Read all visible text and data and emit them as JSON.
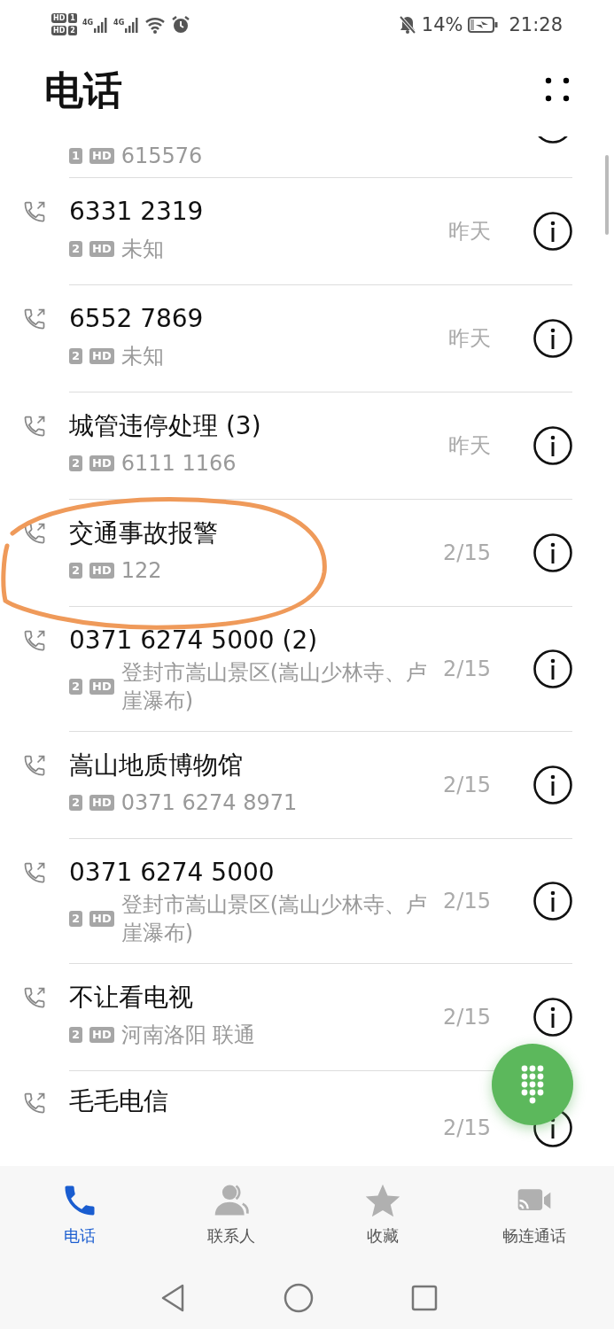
{
  "status_bar": {
    "sims": [
      {
        "hd": "HD",
        "slot": "1"
      },
      {
        "hd": "HD",
        "slot": "2"
      }
    ],
    "networks": [
      "4G",
      "4G"
    ],
    "battery": "14%",
    "time": "21:28"
  },
  "title": "电话",
  "calls": [
    {
      "kind": "partial",
      "sim": "1",
      "quality": "HD",
      "detail": "615576"
    },
    {
      "kind": "full",
      "name": "6331 2319",
      "sim": "2",
      "quality": "HD",
      "detail": "未知",
      "time": "昨天",
      "circled": false
    },
    {
      "kind": "full",
      "name": "6552 7869",
      "sim": "2",
      "quality": "HD",
      "detail": "未知",
      "time": "昨天",
      "circled": false
    },
    {
      "kind": "full",
      "name": "城管违停处理 (3)",
      "sim": "2",
      "quality": "HD",
      "detail": "6111 1166",
      "time": "昨天",
      "circled": false
    },
    {
      "kind": "full",
      "name": "交通事故报警",
      "sim": "2",
      "quality": "HD",
      "detail": "122",
      "time": "2/15",
      "circled": true
    },
    {
      "kind": "full",
      "name": "0371 6274 5000 (2)",
      "sim": "2",
      "quality": "HD",
      "detail": "登封市嵩山景区(嵩山少林寺、卢崖瀑布)",
      "time": "2/15",
      "circled": false
    },
    {
      "kind": "full",
      "name": "嵩山地质博物馆",
      "sim": "2",
      "quality": "HD",
      "detail": "0371 6274 8971",
      "time": "2/15",
      "circled": false
    },
    {
      "kind": "full",
      "name": "0371 6274 5000",
      "sim": "2",
      "quality": "HD",
      "detail": "登封市嵩山景区(嵩山少林寺、卢崖瀑布)",
      "time": "2/15",
      "circled": false
    },
    {
      "kind": "full",
      "name": "不让看电视",
      "sim": "2",
      "quality": "HD",
      "detail": "河南洛阳 联通",
      "time": "2/15",
      "circled": false
    },
    {
      "kind": "cut",
      "name": "毛毛电信",
      "time": "2/15"
    }
  ],
  "nav": {
    "tabs": [
      {
        "label": "电话",
        "selected": true
      },
      {
        "label": "联系人",
        "selected": false
      },
      {
        "label": "收藏",
        "selected": false
      },
      {
        "label": "畅连通话",
        "selected": false
      }
    ]
  }
}
